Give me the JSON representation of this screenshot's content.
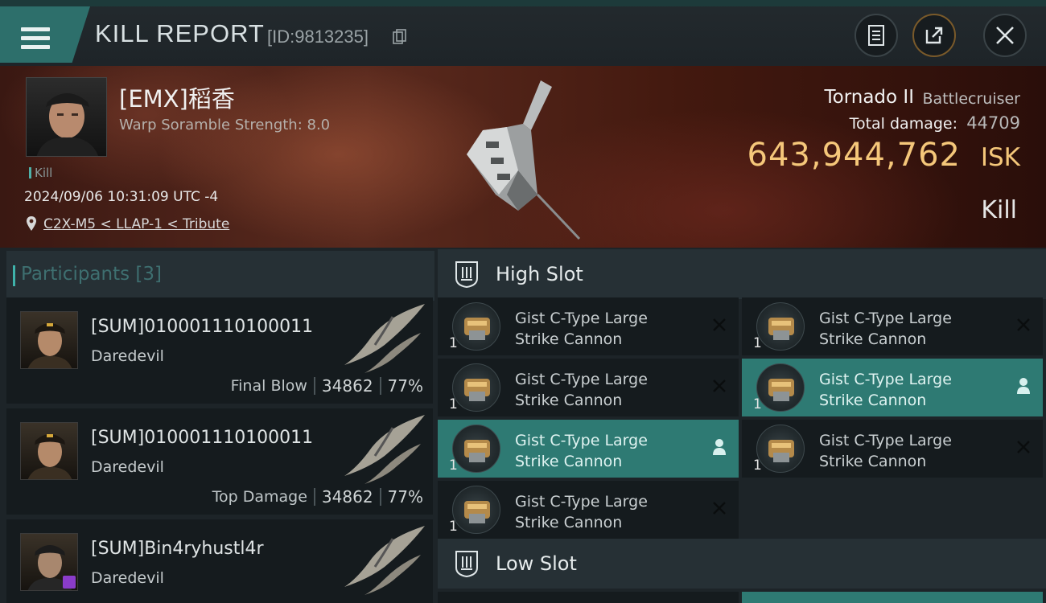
{
  "header": {
    "title": "KILL REPORT",
    "report_id": "[ID:9813235]"
  },
  "victim": {
    "pilot_name": "[EMX]稻香",
    "warp_scramble": "Warp Soramble Strength: 8.0",
    "kill_tag": "Kill",
    "datetime": "2024/09/06 10:31:09 UTC -4",
    "location": "C2X-M5 < LLAP-1 < Tribute",
    "ship_name": "Tornado II",
    "ship_class": "Battlecruiser",
    "total_damage_label": "Total damage:",
    "total_damage": "44709",
    "isk_value": "643,944,762",
    "isk_unit": "ISK",
    "result": "Kill"
  },
  "participants": {
    "title": "Participants [3]",
    "items": [
      {
        "name": "[SUM]010001110100011",
        "ship": "Daredevil",
        "label": "Final Blow",
        "damage": "34862",
        "percent": "77%"
      },
      {
        "name": "[SUM]010001110100011",
        "ship": "Daredevil",
        "label": "Top Damage",
        "damage": "34862",
        "percent": "77%"
      },
      {
        "name": "[SUM]Bin4ryhustl4r",
        "ship": "Daredevil",
        "label": "",
        "damage": "",
        "percent": ""
      }
    ]
  },
  "slots": {
    "high_slot_title": "High Slot",
    "low_slot_title": "Low Slot",
    "high_modules": [
      {
        "name_line1": "Gist C-Type Large",
        "name_line2": "Strike Cannon",
        "qty": "1",
        "state": "destroyed"
      },
      {
        "name_line1": "Gist C-Type Large",
        "name_line2": "Strike Cannon",
        "qty": "1",
        "state": "destroyed"
      },
      {
        "name_line1": "Gist C-Type Large",
        "name_line2": "Strike Cannon",
        "qty": "1",
        "state": "destroyed"
      },
      {
        "name_line1": "Gist C-Type Large",
        "name_line2": "Strike Cannon",
        "qty": "1",
        "state": "dropped"
      },
      {
        "name_line1": "Gist C-Type Large",
        "name_line2": "Strike Cannon",
        "qty": "1",
        "state": "dropped"
      },
      {
        "name_line1": "Gist C-Type Large",
        "name_line2": "Strike Cannon",
        "qty": "1",
        "state": "destroyed"
      },
      {
        "name_line1": "Gist C-Type Large",
        "name_line2": "Strike Cannon",
        "qty": "1",
        "state": "destroyed"
      }
    ]
  },
  "colors": {
    "accent_teal": "#2e7a73",
    "isk_gold": "#f5c77a"
  },
  "icons": [
    "menu-icon",
    "copy-icon",
    "notes-icon",
    "share-icon",
    "close-icon",
    "location-pin-icon",
    "slot-high-icon",
    "slot-low-icon",
    "destroyed-x-icon",
    "dropped-user-icon"
  ]
}
